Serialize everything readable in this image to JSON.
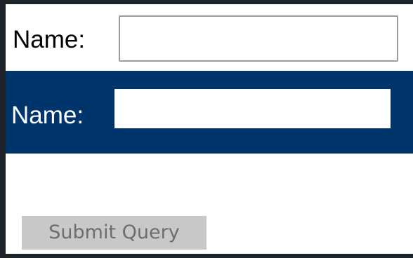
{
  "form": {
    "fields": [
      {
        "label": "Name:",
        "value": "",
        "placeholder": ""
      },
      {
        "label": "Name:",
        "value": "",
        "placeholder": ""
      }
    ],
    "submit_label": "Submit Query"
  },
  "colors": {
    "outer_frame": "#1e2229",
    "page_background": "#ffffff",
    "dark_band": "#00356b",
    "button_background": "#c8c8c8",
    "button_text": "#6d6d6d",
    "input_border": "#9c9c9c"
  }
}
